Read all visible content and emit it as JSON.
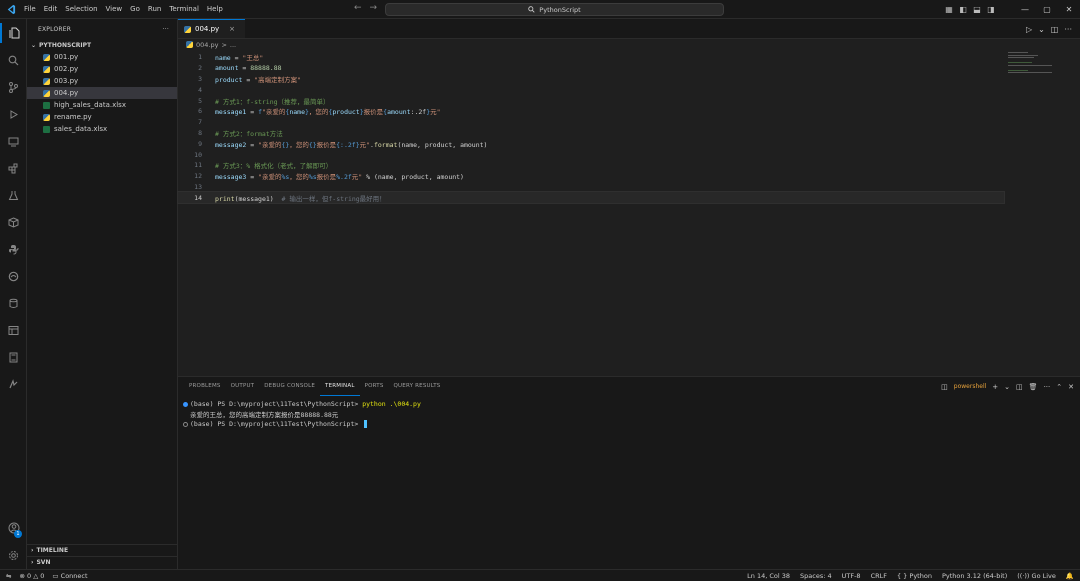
{
  "titlebar": {
    "menu": [
      "File",
      "Edit",
      "Selection",
      "View",
      "Go",
      "Run",
      "Terminal",
      "Help"
    ],
    "search_text": "PythonScript"
  },
  "explorer": {
    "header": "EXPLORER",
    "more": "···",
    "folder": "PYTHONSCRIPT",
    "files": [
      {
        "name": "001.py",
        "type": "py"
      },
      {
        "name": "002.py",
        "type": "py"
      },
      {
        "name": "003.py",
        "type": "py"
      },
      {
        "name": "004.py",
        "type": "py",
        "active": true
      },
      {
        "name": "high_sales_data.xlsx",
        "type": "xlsx"
      },
      {
        "name": "rename.py",
        "type": "py"
      },
      {
        "name": "sales_data.xlsx",
        "type": "xlsx"
      }
    ],
    "timeline": "TIMELINE",
    "svn": "SVN"
  },
  "editor": {
    "tab": {
      "label": "004.py",
      "close": "×"
    },
    "breadcrumb": {
      "file": "004.py",
      "sep": ">",
      "rest": "..."
    },
    "current_line": 14,
    "lines": [
      {
        "n": "1",
        "tokens": [
          [
            "v",
            "name"
          ],
          [
            "op",
            " = "
          ],
          [
            "s",
            "\"王总\""
          ]
        ]
      },
      {
        "n": "2",
        "tokens": [
          [
            "v",
            "amount"
          ],
          [
            "op",
            " = "
          ],
          [
            "n",
            "88888.88"
          ]
        ]
      },
      {
        "n": "3",
        "tokens": [
          [
            "v",
            "product"
          ],
          [
            "op",
            " = "
          ],
          [
            "s",
            "\"高端定制方案\""
          ]
        ]
      },
      {
        "n": "4",
        "tokens": []
      },
      {
        "n": "5",
        "tokens": [
          [
            "c",
            "# 方式1：f-string（推荐，最简单）"
          ]
        ]
      },
      {
        "n": "6",
        "tokens": [
          [
            "v",
            "message1"
          ],
          [
            "op",
            " = "
          ],
          [
            "k",
            "f"
          ],
          [
            "s",
            "\"亲爱的"
          ],
          [
            "k",
            "{"
          ],
          [
            "v",
            "name"
          ],
          [
            "k",
            "}"
          ],
          [
            "s",
            "，您的"
          ],
          [
            "k",
            "{"
          ],
          [
            "v",
            "product"
          ],
          [
            "k",
            "}"
          ],
          [
            "s",
            "报价是"
          ],
          [
            "k",
            "{"
          ],
          [
            "v",
            "amount"
          ],
          [
            "op",
            ":.2f"
          ],
          [
            "k",
            "}"
          ],
          [
            "s",
            "元\""
          ]
        ]
      },
      {
        "n": "7",
        "tokens": []
      },
      {
        "n": "8",
        "tokens": [
          [
            "c",
            "# 方式2：format方法"
          ]
        ]
      },
      {
        "n": "9",
        "tokens": [
          [
            "v",
            "message2"
          ],
          [
            "op",
            " = "
          ],
          [
            "s",
            "\"亲爱的"
          ],
          [
            "k",
            "{}"
          ],
          [
            "s",
            "，您的"
          ],
          [
            "k",
            "{}"
          ],
          [
            "s",
            "报价是"
          ],
          [
            "k",
            "{:.2f}"
          ],
          [
            "s",
            "元\""
          ],
          [
            "pl",
            "."
          ],
          [
            "f",
            "format"
          ],
          [
            "pl",
            "(name, product, amount)"
          ]
        ]
      },
      {
        "n": "10",
        "tokens": []
      },
      {
        "n": "11",
        "tokens": [
          [
            "c",
            "# 方式3：% 格式化（老式，了解即可）"
          ]
        ]
      },
      {
        "n": "12",
        "tokens": [
          [
            "v",
            "message3"
          ],
          [
            "op",
            " = "
          ],
          [
            "s",
            "\"亲爱的"
          ],
          [
            "k",
            "%s"
          ],
          [
            "s",
            "，您的"
          ],
          [
            "k",
            "%s"
          ],
          [
            "s",
            "报价是"
          ],
          [
            "k",
            "%.2f"
          ],
          [
            "s",
            "元\""
          ],
          [
            "op",
            " % "
          ],
          [
            "pl",
            "(name, product, amount)"
          ]
        ]
      },
      {
        "n": "13",
        "tokens": []
      },
      {
        "n": "14",
        "tokens": [
          [
            "f",
            "print"
          ],
          [
            "pl",
            "(message1)  "
          ],
          [
            "ghost",
            "# 输出一样，但f-string最好用！"
          ]
        ]
      }
    ]
  },
  "panel": {
    "tabs": [
      "PROBLEMS",
      "OUTPUT",
      "DEBUG CONSOLE",
      "TERMINAL",
      "PORTS",
      "QUERY RESULTS"
    ],
    "active_tab": "TERMINAL",
    "shell": "powershell",
    "terminal": {
      "line1_prompt": "(base) PS D:\\myproject\\11Test\\PythonScript> ",
      "line1_cmd": "python .\\004.py",
      "line2_output": "亲爱的王总，您的高端定制方案报价是88888.88元",
      "line3_prompt": "(base) PS D:\\myproject\\11Test\\PythonScript> "
    }
  },
  "statusbar": {
    "errors": "0",
    "warnings": "0",
    "connect": "Connect",
    "position": "Ln 14, Col 38",
    "spaces": "Spaces: 4",
    "encoding": "UTF-8",
    "eol": "CRLF",
    "language_braces": "{ }",
    "language": "Python",
    "interpreter": "Python 3.12 (64-bit)",
    "golive": "Go Live"
  },
  "accounts_badge": "1",
  "colors": {
    "accent": "#0078d4",
    "background": "#1f1f1f",
    "sidebar": "#181818"
  }
}
